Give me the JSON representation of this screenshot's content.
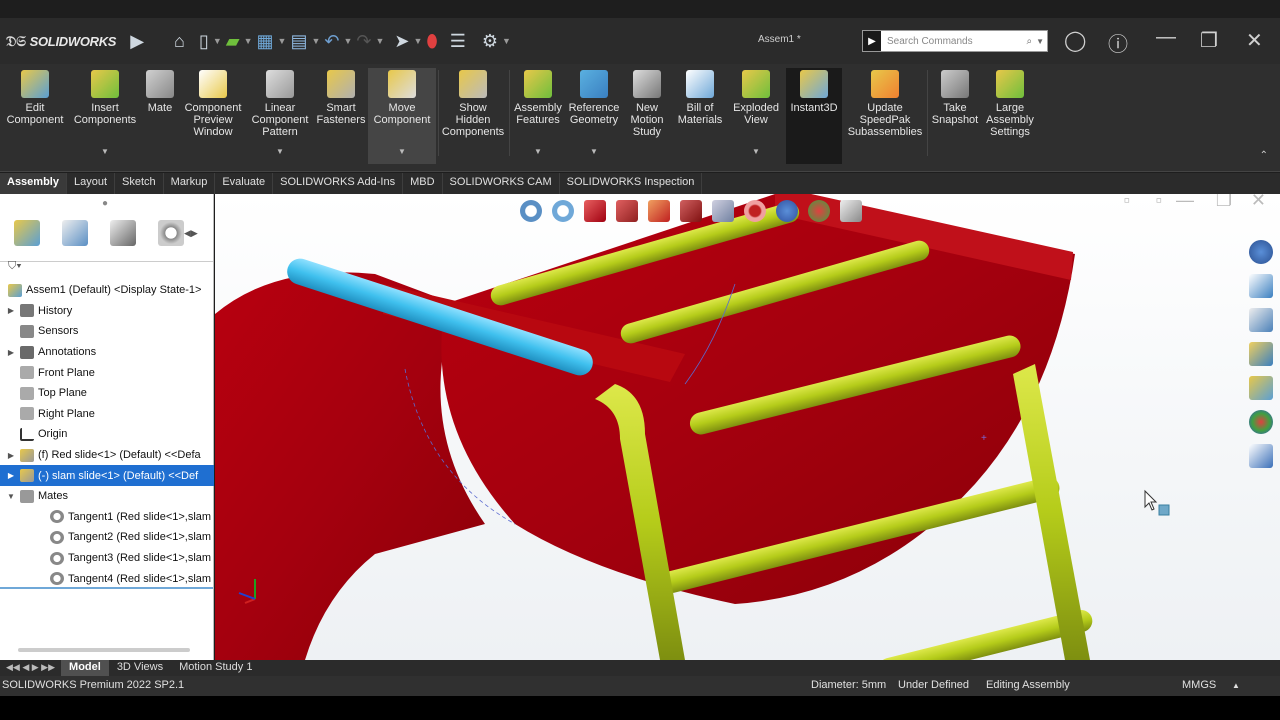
{
  "app": {
    "name": "SOLIDWORKS",
    "document_title": "Assem1 *",
    "search_placeholder": "Search Commands"
  },
  "ribbon": {
    "buttons": [
      {
        "label": "Edit\nComponent"
      },
      {
        "label": "Insert\nComponents"
      },
      {
        "label": "Mate"
      },
      {
        "label": "Component\nPreview\nWindow"
      },
      {
        "label": "Linear\nComponent\nPattern"
      },
      {
        "label": "Smart\nFasteners"
      },
      {
        "label": "Move\nComponent"
      },
      {
        "label": "Show\nHidden\nComponents"
      },
      {
        "label": "Assembly\nFeatures"
      },
      {
        "label": "Reference\nGeometry"
      },
      {
        "label": "New\nMotion\nStudy"
      },
      {
        "label": "Bill of\nMaterials"
      },
      {
        "label": "Exploded\nView"
      },
      {
        "label": "Instant3D"
      },
      {
        "label": "Update\nSpeedPak\nSubassemblies"
      },
      {
        "label": "Take\nSnapshot"
      },
      {
        "label": "Large\nAssembly\nSettings"
      }
    ]
  },
  "command_tabs": [
    "Assembly",
    "Layout",
    "Sketch",
    "Markup",
    "Evaluate",
    "SOLIDWORKS Add-Ins",
    "MBD",
    "SOLIDWORKS CAM",
    "SOLIDWORKS Inspection"
  ],
  "tree": {
    "root": "Assem1 (Default) <Display State-1>",
    "items": [
      {
        "label": "History"
      },
      {
        "label": "Sensors"
      },
      {
        "label": "Annotations"
      },
      {
        "label": "Front Plane"
      },
      {
        "label": "Top Plane"
      },
      {
        "label": "Right Plane"
      },
      {
        "label": "Origin"
      },
      {
        "label": "(f) Red slide<1> (Default) <<Defa"
      },
      {
        "label": "(-) slam slide<1> (Default) <<Def"
      },
      {
        "label": "Mates"
      },
      {
        "label": "Tangent1 (Red slide<1>,slam"
      },
      {
        "label": "Tangent2 (Red slide<1>,slam"
      },
      {
        "label": "Tangent3 (Red slide<1>,slam"
      },
      {
        "label": "Tangent4 (Red slide<1>,slam"
      }
    ]
  },
  "bottom_tabs": [
    "Model",
    "3D Views",
    "Motion Study 1"
  ],
  "status": {
    "product": "SOLIDWORKS Premium 2022 SP2.1",
    "diameter": "Diameter: 5mm",
    "definition": "Under Defined",
    "mode": "Editing Assembly",
    "units": "MMGS"
  },
  "colors": {
    "slide_red": "#a4000e",
    "rail_yellow": "#b5cc1a",
    "selected_blue": "#3fc0ee",
    "tree_selection": "#1f6fd1"
  }
}
